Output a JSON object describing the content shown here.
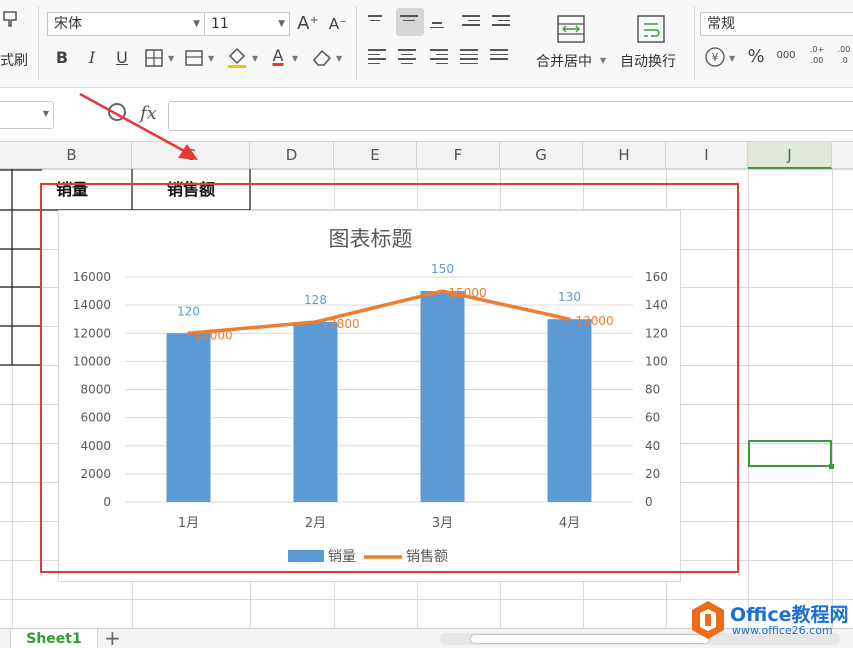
{
  "ribbon": {
    "format_painter_label": "式刷",
    "font_name": "宋体",
    "font_size": "11",
    "merge_center_label": "合并居中",
    "wrap_text_label": "自动换行",
    "number_format": "常规",
    "bold_label": "B",
    "italic_label": "I",
    "underline_label": "U",
    "font_color_label": "A",
    "increase_font_label": "A⁺",
    "decrease_font_label": "A⁻",
    "percent_label": "%",
    "thousands_label": "000",
    "inc_decimal_label": ".0+ .00",
    "dec_decimal_label": ".00 .0",
    "icons": {
      "format_painter": "format-painter-icon",
      "borders": "borders-icon",
      "cell_style": "cell-style-icon",
      "fill_color": "fill-color-icon",
      "clear": "eraser-icon",
      "merge": "merge-center-icon",
      "wrap": "wrap-text-icon",
      "currency": "yen-icon"
    }
  },
  "formula_bar": {
    "fx_label": "fx",
    "name_box_value": "",
    "formula_value": ""
  },
  "columns": [
    "B",
    "C",
    "D",
    "E",
    "F",
    "G",
    "H",
    "I",
    "J"
  ],
  "selected_column": "J",
  "header_cells": {
    "B": "销量",
    "C": "销售额"
  },
  "chart_data": {
    "type": "bar",
    "title": "图表标题",
    "categories": [
      "1月",
      "2月",
      "3月",
      "4月"
    ],
    "series": [
      {
        "name": "销量",
        "type": "bar",
        "axis": "secondary",
        "values": [
          120,
          128,
          150,
          130
        ],
        "color": "#5b9bd5"
      },
      {
        "name": "销售额",
        "type": "line",
        "axis": "primary",
        "values": [
          12000,
          12800,
          15000,
          13000
        ],
        "color": "#ed7d31"
      }
    ],
    "primary_axis": {
      "ylim": [
        0,
        16000
      ],
      "ticks": [
        0,
        2000,
        4000,
        6000,
        8000,
        10000,
        12000,
        14000,
        16000
      ]
    },
    "secondary_axis": {
      "ylim": [
        0,
        160
      ],
      "ticks": [
        0,
        20,
        40,
        60,
        80,
        100,
        120,
        140,
        160
      ]
    },
    "grid": true,
    "legend": "bottom"
  },
  "sheet": {
    "tab_name": "Sheet1",
    "add_label": "+"
  },
  "watermark": {
    "brand": "Office教程网",
    "url": "www.office26.com"
  },
  "colors": {
    "accent_green": "#3a9b3a",
    "highlight_red": "#e53935"
  }
}
